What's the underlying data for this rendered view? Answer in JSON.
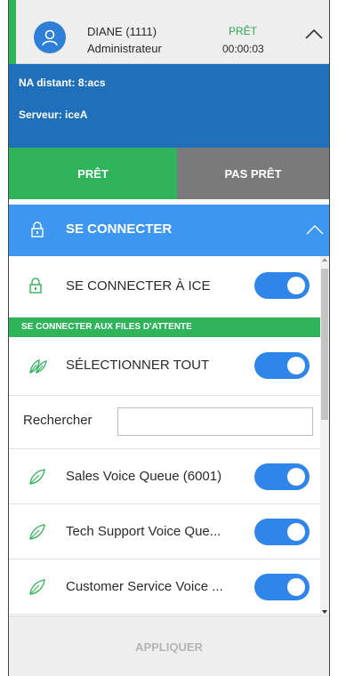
{
  "agent": {
    "name": "DIANE (1111)",
    "role": "Administrateur",
    "state": "PRÊT",
    "timer": "00:00:03"
  },
  "info": {
    "remote_na": "NA distant: 8:acs",
    "server": "Serveur: iceA"
  },
  "actions": {
    "ready": "PRÊT",
    "not_ready": "PAS PRÊT"
  },
  "connect": {
    "title": "SE CONNECTER",
    "ice_label": "SE CONNECTER À ICE",
    "queues_banner": "SE CONNECTER AUX FILES D'ATTENTE",
    "select_all": "SÉLECTIONNER TOUT",
    "search_label": "Rechercher",
    "search_value": "",
    "queues": [
      {
        "label": "Sales Voice Queue (6001)",
        "on": true
      },
      {
        "label": "Tech Support Voice Que...",
        "on": true
      },
      {
        "label": "Customer Service Voice ...",
        "on": true
      }
    ]
  },
  "footer": {
    "apply": "APPLIQUER"
  },
  "colors": {
    "ready_green": "#2fb35b",
    "info_blue": "#1f6fba",
    "header_blue": "#3d97f0",
    "toggle_blue": "#2f86e8",
    "not_ready_gray": "#7a7a7a"
  }
}
